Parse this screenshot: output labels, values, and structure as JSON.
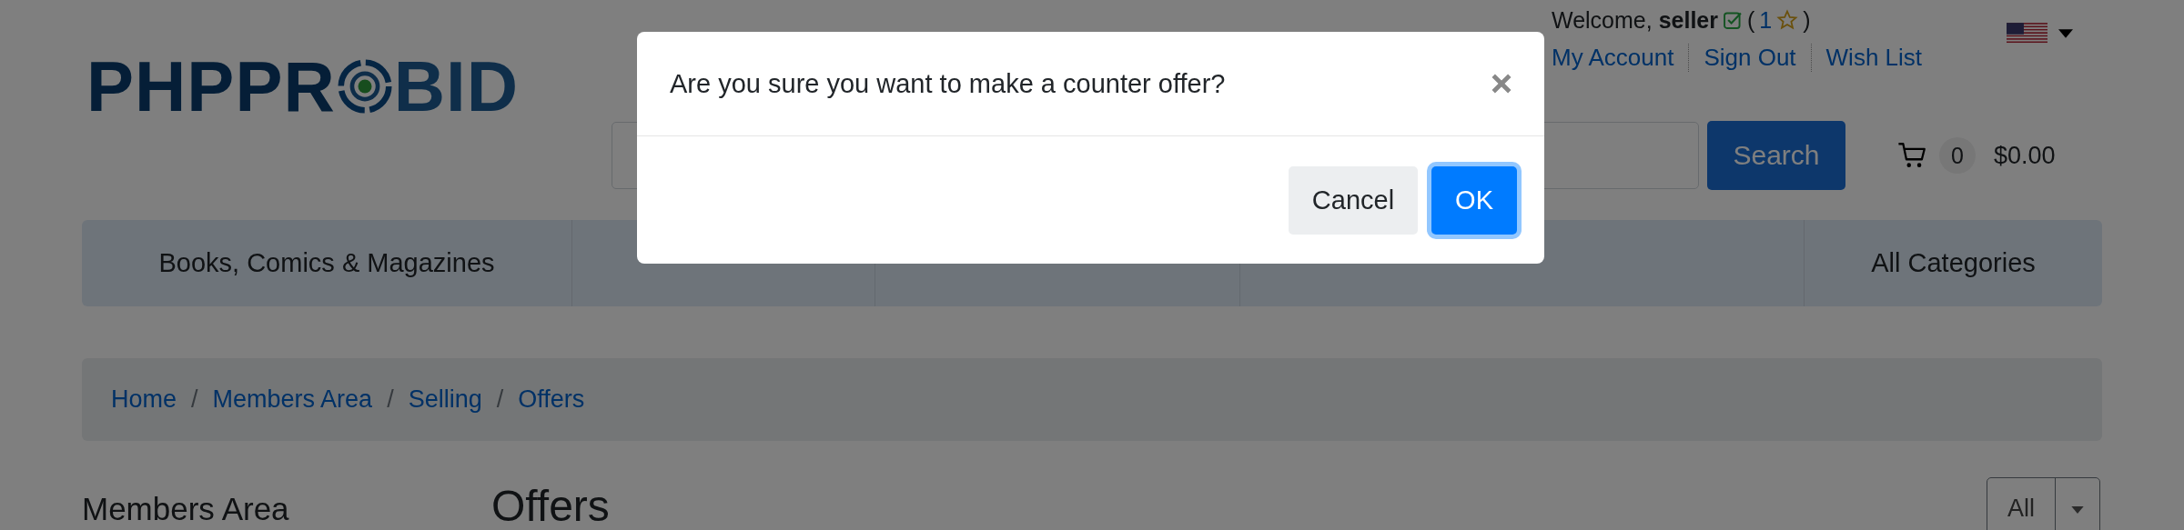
{
  "logo": {
    "text_before": "PHPPR",
    "text_after": "BID"
  },
  "user": {
    "welcome": "Welcome, **seller**",
    "feedback_open": "(",
    "feedback_score": "1",
    "feedback_close": ")",
    "links": [
      "My Account",
      "Sign Out",
      "Wish List"
    ]
  },
  "search": {
    "button": "Search"
  },
  "cart": {
    "count": "0",
    "total": "$0.00"
  },
  "categories": [
    "Books, Comics & Magazines",
    "All Categories"
  ],
  "breadcrumb": {
    "separator": "/",
    "items": [
      "Home",
      "Members Area",
      "Selling",
      "Offers"
    ]
  },
  "sidebar": {
    "title": "Members Area"
  },
  "content": {
    "title": "Offers",
    "filter": "All"
  },
  "dialog": {
    "message": "Are you sure you want to make a counter offer?",
    "buttons": [
      {
        "label": "Cancel",
        "kind": "secondary",
        "focused": false
      },
      {
        "label": "OK",
        "kind": "primary",
        "focused": true
      }
    ]
  }
}
